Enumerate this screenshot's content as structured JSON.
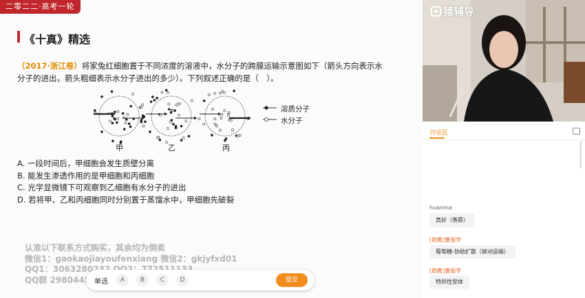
{
  "course_tag": "二零二二·高考一轮",
  "title": "《十真》精选",
  "question": {
    "source": "（2017·浙江卷）",
    "text": "将家兔红细胞置于不同浓度的溶液中，水分子的跨膜运输示意图如下（箭头方向表示水分子的进出，箭头粗细表示水分子进出的多少）。下列叙述正确的是（　）。"
  },
  "figure": {
    "cells": [
      {
        "label": "甲",
        "solute": 14,
        "water": 7,
        "in": "thick",
        "out": "thin"
      },
      {
        "label": "乙",
        "solute": 10,
        "water": 10,
        "in": "thin",
        "out": "thin"
      },
      {
        "label": "丙",
        "solute": 7,
        "water": 14,
        "in": "thin",
        "out": "thick"
      }
    ],
    "legend": [
      {
        "symbol": "filled",
        "label": "溶质分子"
      },
      {
        "symbol": "hollow",
        "label": "水分子"
      }
    ]
  },
  "options": [
    "A. 一段时间后，甲细胞会发生质壁分离",
    "B. 能发生渗透作用的是甲细胞和丙细胞",
    "C. 光学显微镜下可观察到乙细胞有水分子的进出",
    "D. 若将甲、乙和丙细胞同时分别置于蒸馏水中，甲细胞先破裂"
  ],
  "watermark": [
    "认准以下联系方式购买，其余均为倒卖",
    "微信1：gaokaojiayoufenxiang 微信2：gkjyfxd01",
    "QQ1：3063280232 QQ2：772511133",
    "QQ群 298044531"
  ],
  "answer_bar": {
    "question_type": "单选",
    "choices": [
      "A",
      "B",
      "C",
      "D"
    ],
    "submit_label": "提交"
  },
  "video": {
    "brand": "猿辅导"
  },
  "chat": {
    "tab_label": "讨论区",
    "messages": [
      {
        "user": "huanma",
        "assistant": false,
        "text": "真好（羡慕）"
      },
      {
        "user": "[助教]曹振宇",
        "assistant": true,
        "text": "葡萄糖-协助扩散（被动运输）"
      },
      {
        "user": "[助教]曹振宇",
        "assistant": true,
        "text": "特异性受体"
      }
    ]
  },
  "colors": {
    "accent_red": "#c0262b",
    "source_orange": "#e08a00",
    "submit_orange": "#f28c1c"
  }
}
